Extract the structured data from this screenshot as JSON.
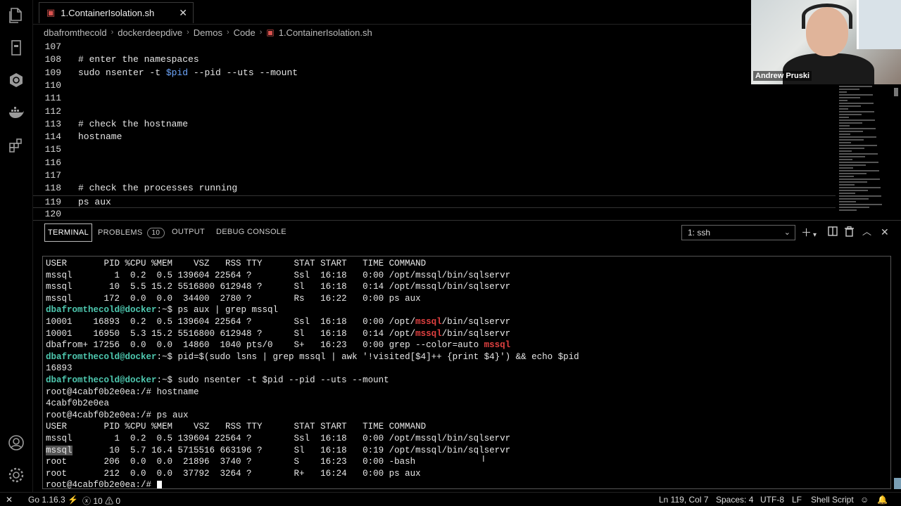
{
  "tab": {
    "title": "1.ContainerIsolation.sh",
    "close": "✕"
  },
  "breadcrumb": [
    "dbafromthecold",
    "dockerdeepdive",
    "Demos",
    "Code",
    "1.ContainerIsolation.sh"
  ],
  "editor": {
    "lines": [
      {
        "n": "107",
        "text": ""
      },
      {
        "n": "108",
        "text": "# enter the namespaces",
        "kind": "comment"
      },
      {
        "n": "109",
        "pre": "sudo nsenter -t ",
        "var": "$pid",
        "post": " --pid --uts --mount",
        "kind": "mixed"
      },
      {
        "n": "110",
        "text": ""
      },
      {
        "n": "111",
        "text": ""
      },
      {
        "n": "112",
        "text": ""
      },
      {
        "n": "113",
        "text": "# check the hostname",
        "kind": "comment"
      },
      {
        "n": "114",
        "text": "hostname"
      },
      {
        "n": "115",
        "text": ""
      },
      {
        "n": "116",
        "text": ""
      },
      {
        "n": "117",
        "text": ""
      },
      {
        "n": "118",
        "text": "# check the processes running",
        "kind": "comment"
      },
      {
        "n": "119",
        "text": "ps aux",
        "current": true
      },
      {
        "n": "120",
        "text": ""
      }
    ]
  },
  "webcam": {
    "name": "Andrew Pruski"
  },
  "panel": {
    "tabs": [
      "TERMINAL",
      "PROBLEMS",
      "OUTPUT",
      "DEBUG CONSOLE"
    ],
    "problems_count": "10",
    "terminal_select": "1: ssh"
  },
  "terminal": {
    "lines": [
      "USER       PID %CPU %MEM    VSZ   RSS TTY      STAT START   TIME COMMAND",
      "mssql        1  0.2  0.5 139604 22564 ?        Ssl  16:18   0:00 /opt/mssql/bin/sqlservr",
      "mssql       10  5.5 15.2 5516800 612948 ?      Sl   16:18   0:14 /opt/mssql/bin/sqlservr",
      "mssql      172  0.0  0.0  34400  2780 ?        Rs   16:22   0:00 ps aux",
      {
        "prompt": "dbafromthecold@docker",
        "rest": ":~$ ps aux | grep mssql"
      },
      {
        "pre": "10001    16893  0.2  0.5 139604 22564 ?        Ssl  16:18   0:00 /opt/",
        "hl": "mssql",
        "post": "/bin/sqlservr"
      },
      {
        "pre": "10001    16950  5.3 15.2 5516800 612948 ?      Sl   16:18   0:14 /opt/",
        "hl": "mssql",
        "post": "/bin/sqlservr"
      },
      {
        "pre": "dbafrom+ 17256  0.0  0.0  14860  1040 pts/0    S+   16:23   0:00 grep --color=auto ",
        "hl": "mssql",
        "post": ""
      },
      {
        "prompt": "dbafromthecold@docker",
        "rest": ":~$ pid=$(sudo lsns | grep mssql | awk '!visited[$4]++ {print $4}') && echo $pid"
      },
      "16893",
      {
        "prompt": "dbafromthecold@docker",
        "rest": ":~$ sudo nsenter -t $pid --pid --uts --mount"
      },
      "root@4cabf0b2e0ea:/# hostname",
      "4cabf0b2e0ea",
      "root@4cabf0b2e0ea:/# ps aux",
      "USER       PID %CPU %MEM    VSZ   RSS TTY      STAT START   TIME COMMAND",
      "mssql        1  0.2  0.5 139604 22564 ?        Ssl  16:18   0:00 /opt/mssql/bin/sqlservr",
      {
        "sel": "mssql",
        "post": "       10  5.7 16.4 5715516 663196 ?      Sl   16:18   0:19 /opt/mssql/bin/sqlservr"
      },
      "root       206  0.0  0.0  21896  3740 ?        S    16:23   0:00 -bash",
      "root       212  0.0  0.0  37792  3264 ?        R+   16:24   0:00 ps aux",
      {
        "cursorline": "root@4cabf0b2e0ea:/# "
      }
    ]
  },
  "status": {
    "go": "Go 1.16.3",
    "errors": "10",
    "warnings": "0",
    "position": "Ln 119, Col 7",
    "spaces": "Spaces: 4",
    "encoding": "UTF-8",
    "eol": "LF",
    "language": "Shell Script"
  },
  "icons": [
    "files-icon",
    "notebook-icon",
    "kubernetes-icon",
    "docker-icon",
    "extensions-icon",
    "account-icon",
    "settings-icon"
  ]
}
